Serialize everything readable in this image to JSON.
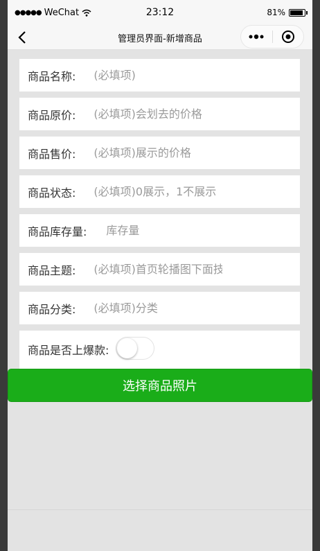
{
  "statusbar": {
    "carrier": "WeChat",
    "time": "23:12",
    "battery": "81%",
    "battery_level": 0.81
  },
  "navbar": {
    "title": "管理员界面-新增商品"
  },
  "form": {
    "name_label": "商品名称:",
    "name_placeholder": "(必填项)",
    "original_price_label": "商品原价:",
    "original_price_placeholder": "(必填项)会划去的价格",
    "sale_price_label": "商品售价:",
    "sale_price_placeholder": "(必填项)展示的价格",
    "status_label": "商品状态:",
    "status_placeholder": "(必填项)0展示，1不展示",
    "stock_label": "商品库存量:",
    "stock_placeholder": "库存量",
    "theme_label": "商品主题:",
    "theme_placeholder": "(必填项)首页轮播图下面技",
    "category_label": "商品分类:",
    "category_placeholder": "(必填项)分类",
    "hot_label": "商品是否上爆款:",
    "hot_enabled": false
  },
  "submit_label": "选择商品照片",
  "colors": {
    "primary": "#1aad19",
    "background": "#e3e3e3"
  }
}
